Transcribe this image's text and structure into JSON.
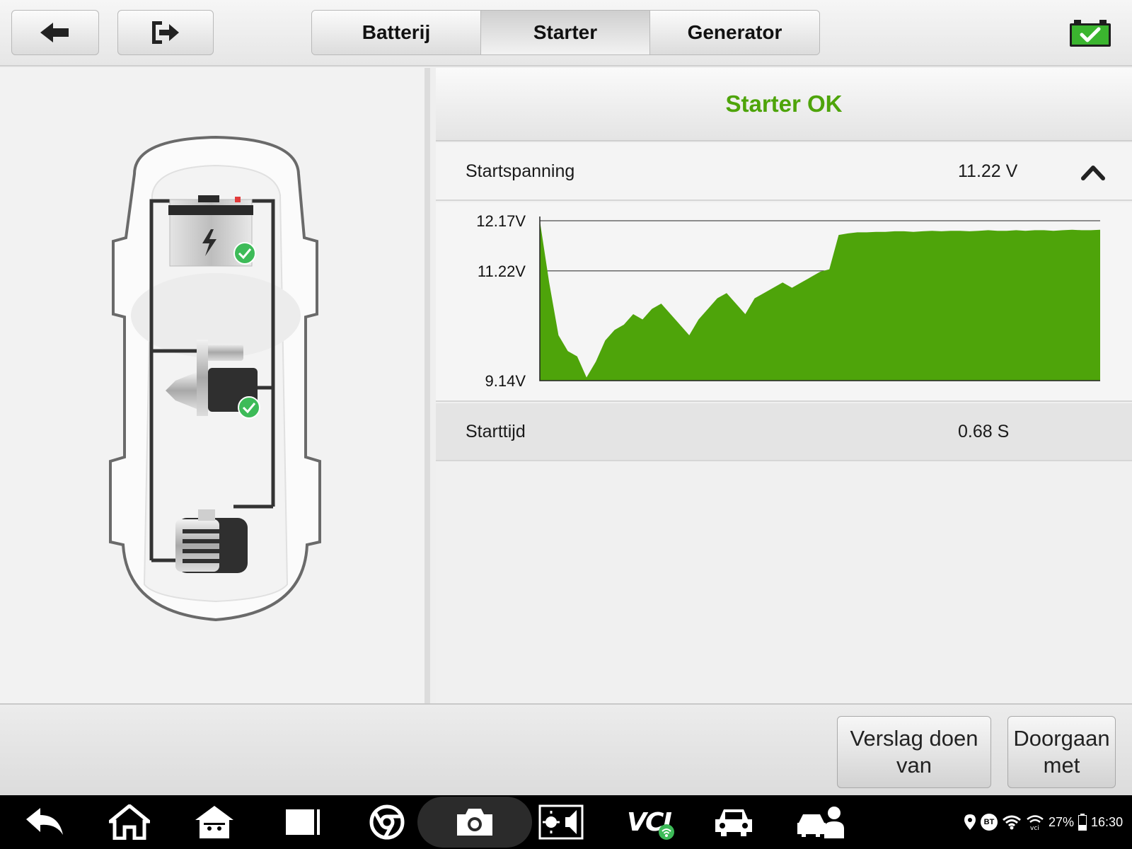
{
  "toolbar": {
    "back_icon": "arrow-left-icon",
    "exit_icon": "exit-icon",
    "tabs": [
      {
        "label": "Batterij",
        "active": false
      },
      {
        "label": "Starter",
        "active": true
      },
      {
        "label": "Generator",
        "active": false
      }
    ],
    "battery_status_icon": "battery-ok-icon",
    "battery_color": "#3bb52f"
  },
  "result": {
    "title": "Starter OK",
    "title_color": "#4ea40a"
  },
  "measurements": {
    "voltage_label": "Startspanning",
    "voltage_value": "11.22 V",
    "time_label": "Starttijd",
    "time_value": "0.68 S"
  },
  "chart_data": {
    "type": "area",
    "y_tick_labels": [
      "12.17V",
      "11.22V",
      "9.14V"
    ],
    "y_ticks": [
      12.17,
      11.22,
      9.14
    ],
    "ylim": [
      9.14,
      12.17
    ],
    "x_range": [
      0,
      0.68
    ],
    "series_color": "#4ea40a",
    "values": [
      12.17,
      11.0,
      10.0,
      9.7,
      9.6,
      9.2,
      9.5,
      9.9,
      10.1,
      10.2,
      10.4,
      10.3,
      10.5,
      10.6,
      10.4,
      10.2,
      10.0,
      10.3,
      10.5,
      10.7,
      10.8,
      10.6,
      10.4,
      10.7,
      10.8,
      10.9,
      11.0,
      10.9,
      11.0,
      11.1,
      11.2,
      11.25,
      11.9,
      11.93,
      11.95,
      11.95,
      11.96,
      11.96,
      11.97,
      11.97,
      11.96,
      11.97,
      11.98,
      11.97,
      11.98,
      11.98,
      11.97,
      11.98,
      11.99,
      11.98,
      11.98,
      11.99,
      11.98,
      11.99,
      11.99,
      11.98,
      11.99,
      12.0,
      11.99,
      11.99,
      12.0
    ]
  },
  "actions": {
    "report_label_1": "Verslag doen",
    "report_label_2": "van",
    "continue_label_1": "Doorgaan",
    "continue_label_2": "met"
  },
  "system_bar": {
    "icons": [
      "back-icon",
      "home-icon",
      "android-home-icon",
      "recent-apps-icon",
      "chrome-icon",
      "camera-icon",
      "brightness-volume-icon",
      "vci-icon",
      "car-icon",
      "car-service-icon"
    ],
    "vci_label": "VCI",
    "status": {
      "bt_label": "BT",
      "battery_percent": "27%",
      "time": "16:30"
    }
  }
}
